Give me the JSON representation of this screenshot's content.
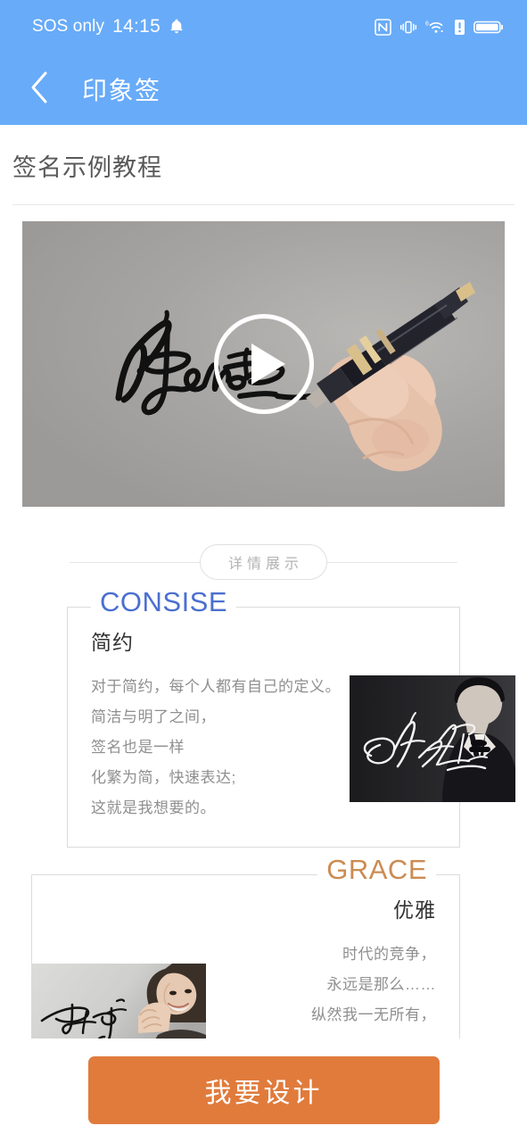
{
  "status_bar": {
    "carrier": "SOS only",
    "time": "14:15",
    "icons": [
      "bell-icon",
      "nfc-icon",
      "vibrate-icon",
      "wifi-6-icon",
      "alert-icon",
      "battery-icon"
    ]
  },
  "nav": {
    "back_icon": "chevron-left-icon",
    "title": "印象签"
  },
  "page": {
    "title": "签名示例教程"
  },
  "video": {
    "play_icon": "play-icon",
    "alt": "hand-writing-signature-with-pen"
  },
  "divider": {
    "label": "详情展示"
  },
  "sections": [
    {
      "key": "consise",
      "heading": "CONSISE",
      "heading_color": "#4a6fd0",
      "subtitle": "简约",
      "lines": [
        "对于简约，每个人都有自己的定义。",
        "简洁与明了之间，",
        "签名也是一样",
        "化繁为简，快速表达;",
        "这就是我想要的。"
      ],
      "photo": "man-in-tuxedo-with-white-signature"
    },
    {
      "key": "grace",
      "heading": "GRACE",
      "heading_color": "#cc8b52",
      "subtitle": "优雅",
      "lines": [
        "时代的竞争，",
        "永远是那么……",
        "纵然我一无所有，"
      ],
      "photo": "woman-portrait-with-black-signature"
    }
  ],
  "cta": {
    "label": "我要设计",
    "color": "#e07b3c"
  },
  "theme": {
    "header_blue": "#68abf8",
    "accent_orange": "#e07b3c",
    "text_gray": "#8f8f8f"
  }
}
